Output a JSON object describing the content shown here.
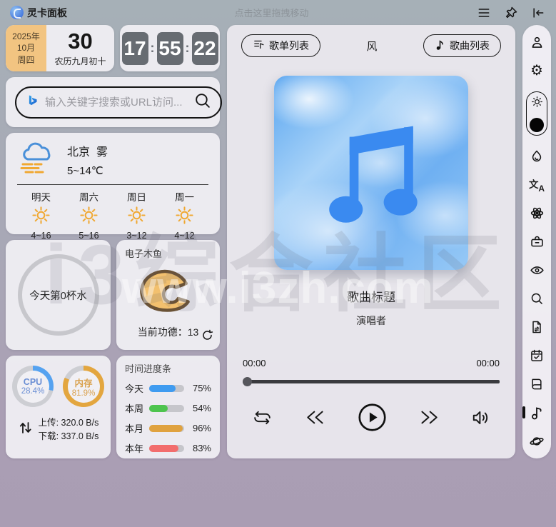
{
  "app": {
    "title": "灵卡面板",
    "drag_hint": "点击这里拖拽移动"
  },
  "date": {
    "year": "2025年",
    "month": "10月",
    "weekday": "周四",
    "day": "30",
    "lunar": "农历九月初十"
  },
  "clock": {
    "hours": "17",
    "minutes": "55",
    "seconds": "22"
  },
  "search": {
    "placeholder": "输入关键字搜索或URL访问..."
  },
  "weather": {
    "city": "北京",
    "condition": "雾",
    "temp_range": "5~14℃",
    "forecast": [
      {
        "day": "明天",
        "temp": "4~16"
      },
      {
        "day": "周六",
        "temp": "5~16"
      },
      {
        "day": "周日",
        "temp": "3~12"
      },
      {
        "day": "周一",
        "temp": "4~12"
      }
    ]
  },
  "water": {
    "label": "今天第0杯水"
  },
  "muyu": {
    "title": "电子木鱼",
    "merit_label": "当前功德：",
    "merit_value": "13"
  },
  "system": {
    "cpu_label": "CPU",
    "cpu_value": "28.4%",
    "cpu_percent": 28.4,
    "cpu_color": "#55a2f0",
    "cpu_text_color": "#6b8fd4",
    "mem_label": "内存",
    "mem_value": "81.9%",
    "mem_percent": 81.9,
    "mem_color": "#e3a63f",
    "mem_text_color": "#d9a04b",
    "upload": "上传: 320.0 B/s",
    "download": "下载: 337.0 B/s"
  },
  "timebars": {
    "title": "时间进度条",
    "items": [
      {
        "label": "今天",
        "percent": "75%",
        "value": 75,
        "color": "#3f9bf0"
      },
      {
        "label": "本周",
        "percent": "54%",
        "value": 54,
        "color": "#4ec44e"
      },
      {
        "label": "本月",
        "percent": "96%",
        "value": 96,
        "color": "#e0a23f"
      },
      {
        "label": "本年",
        "percent": "83%",
        "value": 83,
        "color": "#f26d6d"
      }
    ]
  },
  "player": {
    "playlist_button": "歌单列表",
    "header_title": "风",
    "songlist_button": "歌曲列表",
    "song_title": "歌曲标题",
    "artist": "演唱者",
    "time_current": "00:00",
    "time_total": "00:00",
    "note_color": "#3a8af0"
  },
  "sidebar": {
    "icons": [
      "user",
      "settings",
      "theme-toggle-sun",
      "theme-toggle-moon",
      "flame",
      "translate",
      "atom",
      "toolbox",
      "eye",
      "search",
      "file-transfer",
      "calendar-check",
      "book",
      "music-note",
      "planet"
    ],
    "active": "music-note"
  },
  "watermark": {
    "line1": "i3综合社区",
    "line2": "www.i3zh.com"
  }
}
